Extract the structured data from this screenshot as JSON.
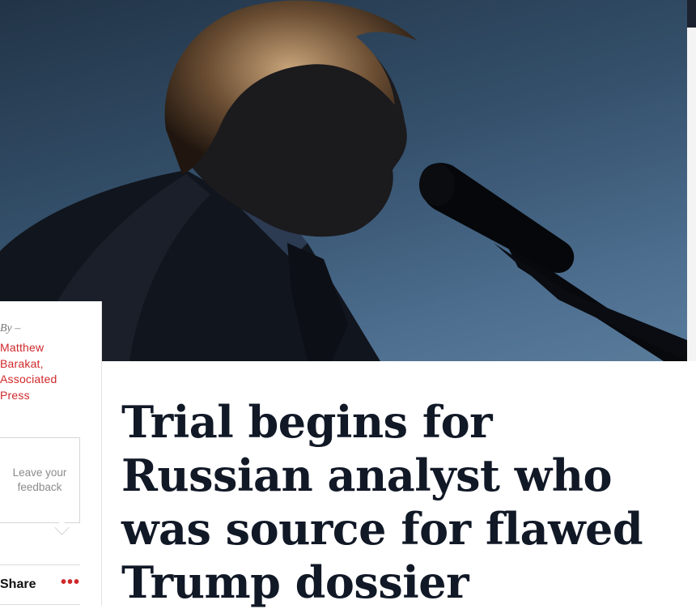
{
  "hero_image": {
    "description_icon": "photo"
  },
  "byline": {
    "prefix": "By –",
    "author": "Matthew Barakat, Associated Press"
  },
  "feedback": {
    "label": "Leave your feedback"
  },
  "share": {
    "label": "Share",
    "more_icon": "•••"
  },
  "article": {
    "headline": "Trial begins for Russian analyst who was source for flawed Trump dossier"
  },
  "colors": {
    "accent": "#d0282b",
    "headline": "#111826",
    "sky": "#34506b"
  }
}
